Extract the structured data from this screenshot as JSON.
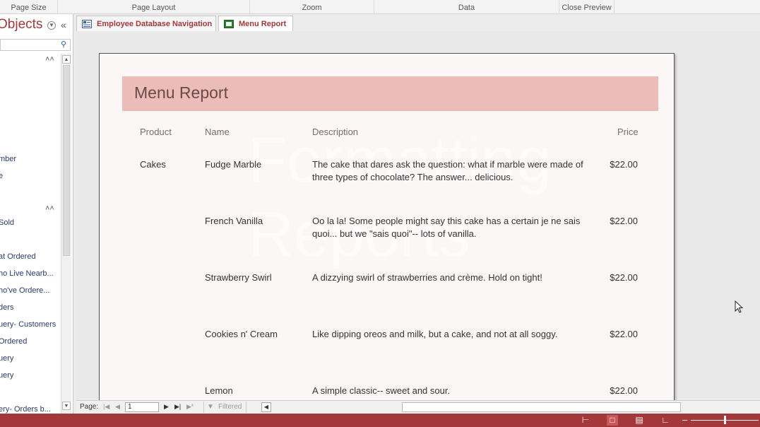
{
  "ribbon": {
    "groups": [
      "Page Size",
      "Page Layout",
      "Zoom",
      "Data",
      "Close Preview"
    ]
  },
  "nav": {
    "title": "Objects",
    "items": [
      "mber",
      "e",
      "Sold",
      "at Ordered",
      "ho Live Nearb...",
      "ho've Ordere...",
      "ders",
      "uery- Customers",
      "Ordered",
      "uery",
      "uery",
      "ery- Orders b..."
    ]
  },
  "tabs": [
    {
      "label": "Employee Database Navigation",
      "active": false
    },
    {
      "label": "Menu Report",
      "active": true
    }
  ],
  "report": {
    "title": "Menu Report",
    "columns": {
      "product": "Product",
      "name": "Name",
      "description": "Description",
      "price": "Price"
    },
    "rows": [
      {
        "product": "Cakes",
        "name": "Fudge Marble",
        "description": "The cake that dares ask the question: what if marble were made of three types of chocolate? The answer... delicious.",
        "price": "$22.00"
      },
      {
        "product": "",
        "name": "French Vanilla",
        "description": "Oo la la! Some people might say this cake has a certain je ne sais quoi... but we \"sais quoi\"-- lots of vanilla.",
        "price": "$22.00"
      },
      {
        "product": "",
        "name": "Strawberry Swirl",
        "description": "A dizzying swirl of strawberries and crème. Hold on tight!",
        "price": "$22.00"
      },
      {
        "product": "",
        "name": "Cookies n' Cream",
        "description": "Like dipping oreos and milk, but a cake, and not at all soggy.",
        "price": "$22.00"
      },
      {
        "product": "",
        "name": "Lemon",
        "description": "A simple classic-- sweet and sour.",
        "price": "$22.00"
      }
    ],
    "watermark": [
      "Formatting",
      "Reports"
    ]
  },
  "recnav": {
    "page_label": "Page:",
    "page_value": "1",
    "filter_label": "Filtered"
  },
  "colors": {
    "accent": "#a4373a",
    "header_band": "#ecbcb8"
  }
}
